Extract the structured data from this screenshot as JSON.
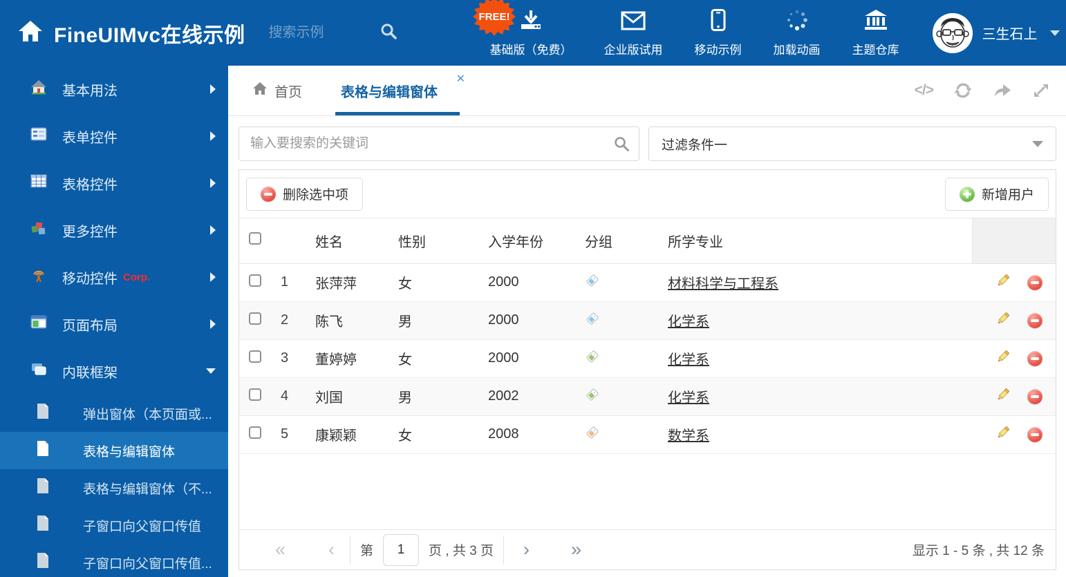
{
  "colors": {
    "header_bg": "#0a5ca6",
    "active_nav_bg": "#1a73b8",
    "active_tab": "#1464a5",
    "delete_red": "#e8574b",
    "add_green": "#6fc24a"
  },
  "header": {
    "title": "FineUIMvc在线示例",
    "search_placeholder": "搜索示例",
    "free_badge": "FREE!",
    "nav": [
      {
        "label": "基础版（免费）"
      },
      {
        "label": "企业版试用"
      },
      {
        "label": "移动示例"
      },
      {
        "label": "加载动画"
      },
      {
        "label": "主题仓库"
      }
    ],
    "user": {
      "name": "三生石上"
    }
  },
  "sidebar": {
    "items": [
      {
        "label": "基本用法"
      },
      {
        "label": "表单控件"
      },
      {
        "label": "表格控件"
      },
      {
        "label": "更多控件"
      },
      {
        "label": "移动控件",
        "badge": "Corp."
      },
      {
        "label": "页面布局"
      },
      {
        "label": "内联框架"
      }
    ],
    "subitems": [
      {
        "label": "弹出窗体（本页面或..."
      },
      {
        "label": "表格与编辑窗体"
      },
      {
        "label": "表格与编辑窗体（不..."
      },
      {
        "label": "子窗口向父窗口传值"
      },
      {
        "label": "子窗口向父窗口传值..."
      }
    ]
  },
  "tabs": [
    {
      "label": "首页"
    },
    {
      "label": "表格与编辑窗体"
    }
  ],
  "tab_tools": {
    "code_glyph": "</>"
  },
  "filters": {
    "search_placeholder": "输入要搜索的关键词",
    "filter_value": "过滤条件一"
  },
  "toolbar": {
    "delete_label": "删除选中项",
    "add_label": "新增用户"
  },
  "table": {
    "columns": [
      "姓名",
      "性别",
      "入学年份",
      "分组",
      "所学专业"
    ],
    "rows": [
      {
        "num": "1",
        "name": "张萍萍",
        "gender": "女",
        "year": "2000",
        "tag_color": "#85c9f4",
        "major": "材料科学与工程系"
      },
      {
        "num": "2",
        "name": "陈飞",
        "gender": "男",
        "year": "2000",
        "tag_color": "#85c9f4",
        "major": "化学系"
      },
      {
        "num": "3",
        "name": "董婷婷",
        "gender": "女",
        "year": "2000",
        "tag_color": "#97c96b",
        "major": "化学系"
      },
      {
        "num": "4",
        "name": "刘国",
        "gender": "男",
        "year": "2002",
        "tag_color": "#97c96b",
        "major": "化学系"
      },
      {
        "num": "5",
        "name": "康颖颖",
        "gender": "女",
        "year": "2008",
        "tag_color": "#f8ba77",
        "major": "数学系"
      }
    ]
  },
  "pagination": {
    "first": "«",
    "prev": "‹",
    "next": "›",
    "last": "»",
    "prefix": "第",
    "page_value": "1",
    "info": "页 , 共 3 页",
    "summary": "显示 1 - 5 条 , 共 12 条"
  }
}
